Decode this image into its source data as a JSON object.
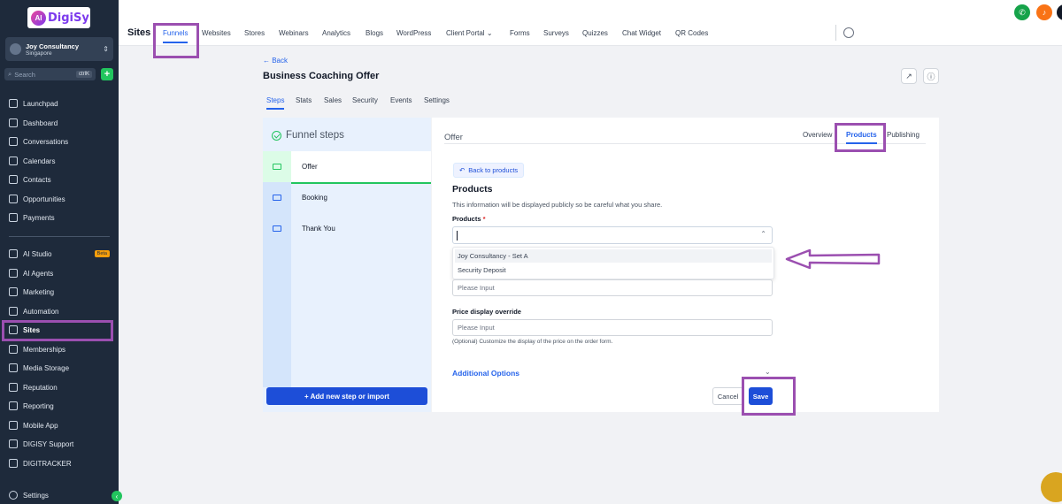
{
  "brand": {
    "logo_text": "DigiSy",
    "logo_mark": "AI"
  },
  "account": {
    "name": "Joy Consultancy",
    "location": "Singapore"
  },
  "sidebar_search": {
    "placeholder": "Search",
    "shortcut": "ctrlK"
  },
  "sidebar": {
    "items": [
      {
        "label": "Launchpad",
        "icon": "rocket-icon"
      },
      {
        "label": "Dashboard",
        "icon": "grid-icon"
      },
      {
        "label": "Conversations",
        "icon": "chat-icon"
      },
      {
        "label": "Calendars",
        "icon": "calendar-icon"
      },
      {
        "label": "Contacts",
        "icon": "contacts-icon"
      },
      {
        "label": "Opportunities",
        "icon": "opportunities-icon"
      },
      {
        "label": "Payments",
        "icon": "payments-icon"
      },
      {
        "label": "AI Studio",
        "icon": "ai-studio-icon",
        "badge": "Beta"
      },
      {
        "label": "AI Agents",
        "icon": "ai-agents-icon"
      },
      {
        "label": "Marketing",
        "icon": "send-icon"
      },
      {
        "label": "Automation",
        "icon": "automation-icon"
      },
      {
        "label": "Sites",
        "icon": "sites-icon"
      },
      {
        "label": "Memberships",
        "icon": "memberships-icon"
      },
      {
        "label": "Media Storage",
        "icon": "media-icon"
      },
      {
        "label": "Reputation",
        "icon": "star-icon"
      },
      {
        "label": "Reporting",
        "icon": "reporting-icon"
      },
      {
        "label": "Mobile App",
        "icon": "mobile-icon"
      },
      {
        "label": "DIGISY Support",
        "icon": "support-icon"
      },
      {
        "label": "DIGITRACKER",
        "icon": "tracker-icon"
      },
      {
        "label": "Settings",
        "icon": "gear-icon"
      }
    ]
  },
  "topbar": {
    "title": "Sites",
    "tabs": [
      "Funnels",
      "Websites",
      "Stores",
      "Webinars",
      "Analytics",
      "Blogs",
      "WordPress",
      "Client Portal",
      "Forms",
      "Surveys",
      "Quizzes",
      "Chat Widget",
      "QR Codes"
    ],
    "client_portal_chevron": "⌄"
  },
  "page": {
    "back": "← Back",
    "title": "Business Coaching Offer",
    "tabs": [
      "Steps",
      "Stats",
      "Sales",
      "Security",
      "Events",
      "Settings"
    ]
  },
  "steps_panel": {
    "heading": "Funnel steps",
    "steps": [
      "Offer",
      "Booking",
      "Thank You"
    ],
    "add_button": "+ Add new step or import"
  },
  "offer_panel": {
    "label": "Offer",
    "tabs": [
      "Overview",
      "Products",
      "Publishing"
    ],
    "back_to_products": "Back to products",
    "section_title": "Products",
    "section_desc": "This information will be displayed publicly so be careful what you share.",
    "products_label": "Products",
    "required_mark": "*",
    "dropdown_options": [
      "Joy Consultancy - Set A",
      "Security Deposit"
    ],
    "input_placeholder": "Please Input",
    "price_override_label": "Price display override",
    "price_override_placeholder": "Please Input",
    "price_hint": "(Optional) Customize the display of the price on the order form.",
    "additional_options": "Additional Options",
    "cancel": "Cancel",
    "save": "Save"
  },
  "colors": {
    "sidebar_bg": "#1e2a3b",
    "accent": "#2563eb",
    "annotation": "#9b4fb0",
    "success": "#22c55e"
  }
}
